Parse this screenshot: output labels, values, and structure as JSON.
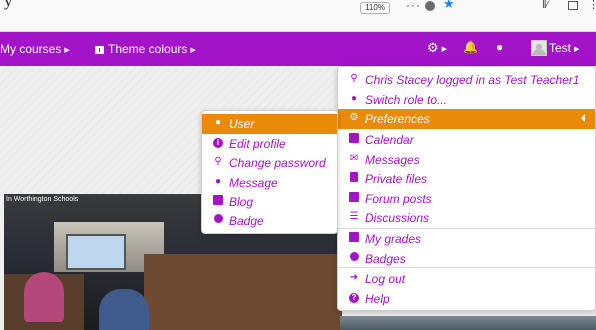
{
  "browser": {
    "title_fragment": "y",
    "zoom_label": "110%",
    "more_label": "···"
  },
  "navbar": {
    "color": "#a313c8",
    "my_courses": "My courses",
    "theme_colours": "Theme colours",
    "user_label": "Test"
  },
  "user_menu": {
    "items": [
      {
        "icon": "key-icon",
        "label": "Chris Stacey logged in as Test Teacher1"
      },
      {
        "icon": "users-icon",
        "label": "Switch role to..."
      },
      {
        "icon": "gear-icon",
        "label": "Preferences",
        "active": true
      },
      {
        "icon": "calendar-icon",
        "label": "Calendar"
      },
      {
        "icon": "envelope-icon",
        "label": "Messages"
      },
      {
        "icon": "file-icon",
        "label": "Private files"
      },
      {
        "icon": "list-box-icon",
        "label": "Forum posts"
      },
      {
        "icon": "list-icon",
        "label": "Discussions"
      },
      {
        "icon": "grades-icon",
        "label": "My grades"
      },
      {
        "icon": "badge-icon",
        "label": "Badges"
      },
      {
        "icon": "sign-out-icon",
        "label": "Log out"
      },
      {
        "icon": "question-icon",
        "label": "Help"
      }
    ]
  },
  "preferences_submenu": {
    "items": [
      {
        "icon": "user-icon",
        "label": "User",
        "active": true
      },
      {
        "icon": "info-icon",
        "label": "Edit profile"
      },
      {
        "icon": "key-icon",
        "label": "Change password"
      },
      {
        "icon": "comment-icon",
        "label": "Message"
      },
      {
        "icon": "rss-icon",
        "label": "Blog"
      },
      {
        "icon": "badge-icon",
        "label": "Badge"
      }
    ]
  },
  "content": {
    "photo_caption": "In Worthington Schools"
  },
  "colors": {
    "accent": "#a313c8",
    "active": "#e98a09"
  }
}
